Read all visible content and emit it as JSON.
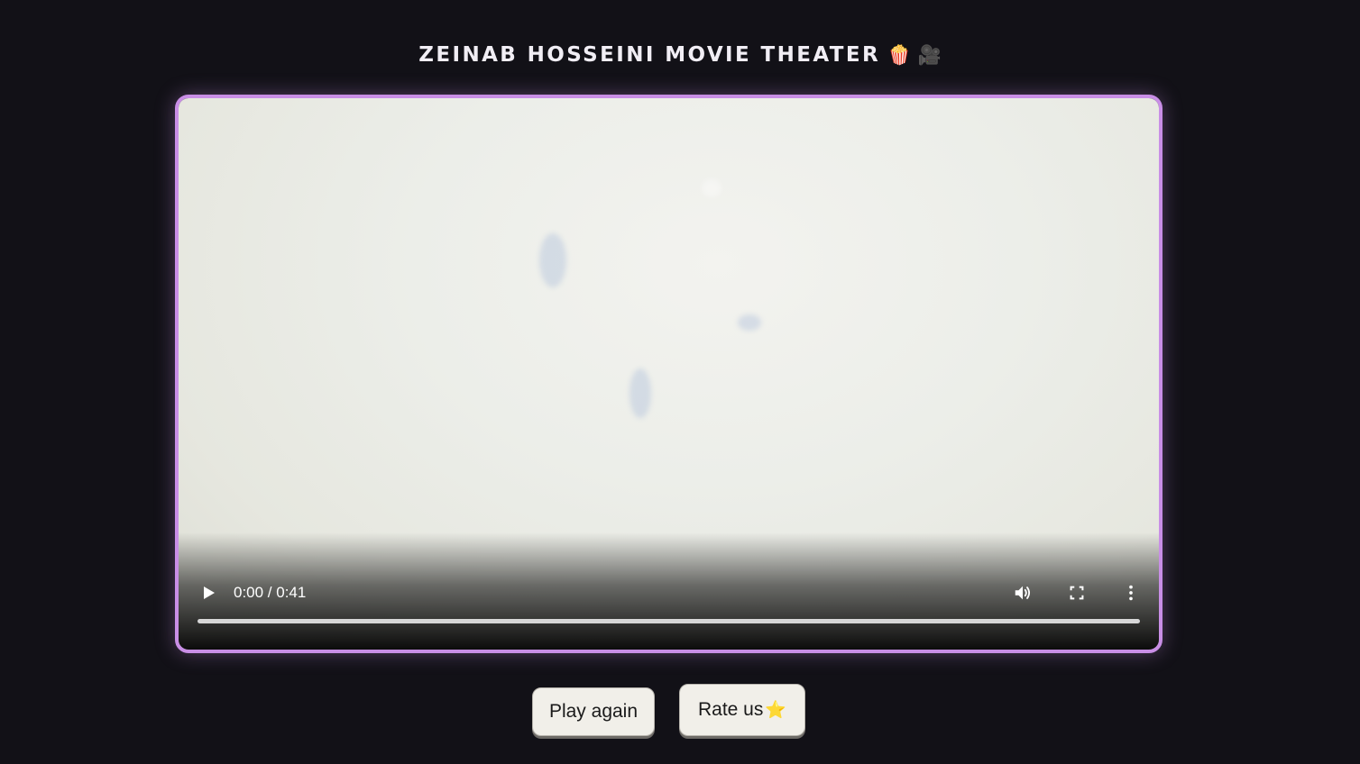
{
  "header": {
    "title": "ZEINAB HOSSEINI MOVIE THEATER",
    "title_emojis": "🍿 🎥"
  },
  "player": {
    "time_display": "0:00 / 0:41",
    "current_time": "0:00",
    "duration": "0:41",
    "progress_fraction": 0,
    "border_color": "#c98ee6",
    "controls": {
      "play_icon": "play-icon",
      "volume_icon": "volume-icon",
      "fullscreen_icon": "fullscreen-icon",
      "more_icon": "more-vertical-icon"
    }
  },
  "actions": {
    "play_again_label": "Play again",
    "rate_label": "Rate us",
    "rate_icon": "⭐"
  },
  "colors": {
    "background": "#121117",
    "button_bg": "#f1efe9"
  }
}
